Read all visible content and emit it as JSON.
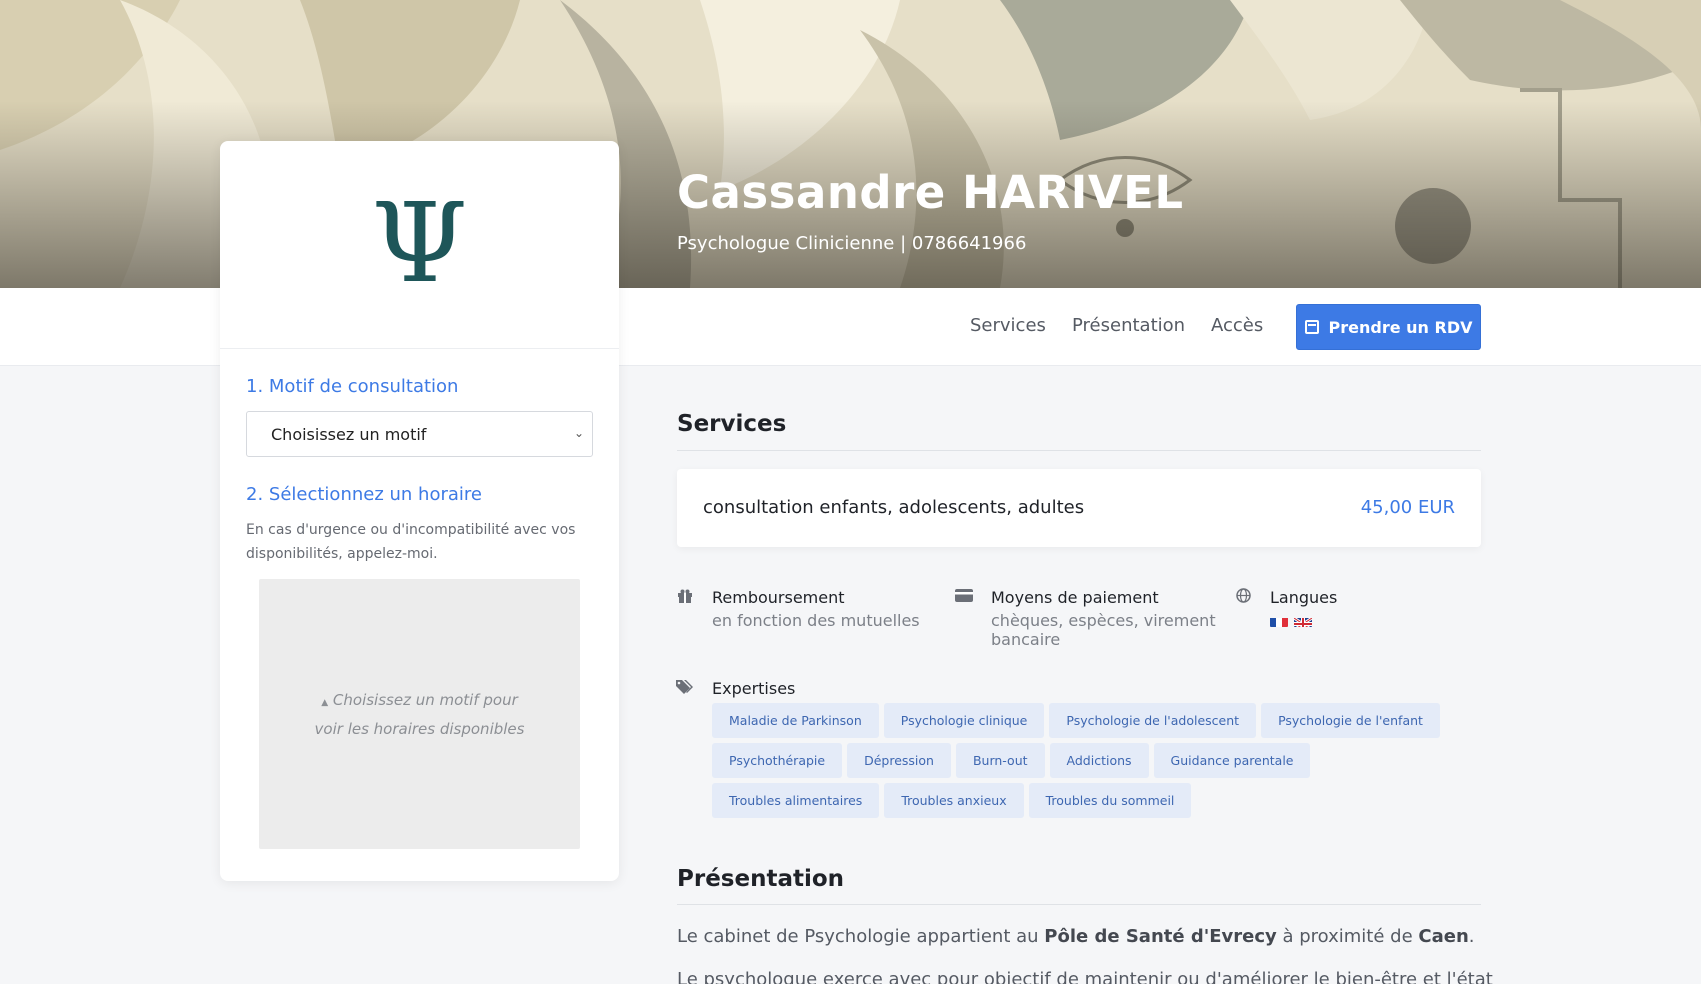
{
  "header": {
    "name": "Cassandre HARIVEL",
    "subtitle": "Psychologue Clinicienne | 0786641966"
  },
  "nav": {
    "items": [
      "Services",
      "Présentation",
      "Accès"
    ],
    "cta_label": "Prendre un RDV",
    "cta_icon": "calendar-icon"
  },
  "booking": {
    "logo_glyph": "Ψ",
    "step1_title": "1. Motif de consultation",
    "select_value": "Choisissez un motif",
    "step2_title": "2. Sélectionnez un horaire",
    "hint": "En cas d'urgence ou d'incompatibilité avec vos disponibilités, appelez-moi.",
    "slots_placeholder": "Choisissez un motif pour voir les horaires disponibles",
    "slots_arrow": "▲"
  },
  "services": {
    "heading": "Services",
    "items": [
      {
        "name": "consultation enfants, adolescents, adultes",
        "price": "45,00 EUR"
      }
    ]
  },
  "info": {
    "reimbursement": {
      "title": "Remboursement",
      "value": "en fonction des mutuelles",
      "icon": "gift-icon"
    },
    "payment": {
      "title": "Moyens de paiement",
      "value": "chèques, espèces, virement bancaire",
      "icon": "credit-card-icon"
    },
    "languages": {
      "title": "Langues",
      "icon": "globe-icon",
      "flags": [
        "fr-flag-icon",
        "uk-flag-icon"
      ]
    },
    "expertises": {
      "title": "Expertises",
      "icon": "tags-icon",
      "tags": [
        "Maladie de Parkinson",
        "Psychologie clinique",
        "Psychologie de l'adolescent",
        "Psychologie de l'enfant",
        "Psychothérapie",
        "Dépression",
        "Burn-out",
        "Addictions",
        "Guidance parentale",
        "Troubles alimentaires",
        "Troubles anxieux",
        "Troubles du sommeil"
      ]
    }
  },
  "presentation": {
    "heading": "Présentation",
    "line1_a": "Le cabinet de Psychologie appartient au ",
    "line1_b": "Pôle de Santé d'Evrecy",
    "line1_c": " à proximité de ",
    "line1_d": "Caen",
    "line1_e": ".",
    "line2": "Le psychologue exerce avec pour objectif de maintenir ou d'améliorer le bien-être et l'état"
  },
  "colors": {
    "accent": "#3d7ae5",
    "logo": "#1e5659",
    "tag_bg": "#e4ebf8",
    "tag_text": "#3e67b1"
  }
}
